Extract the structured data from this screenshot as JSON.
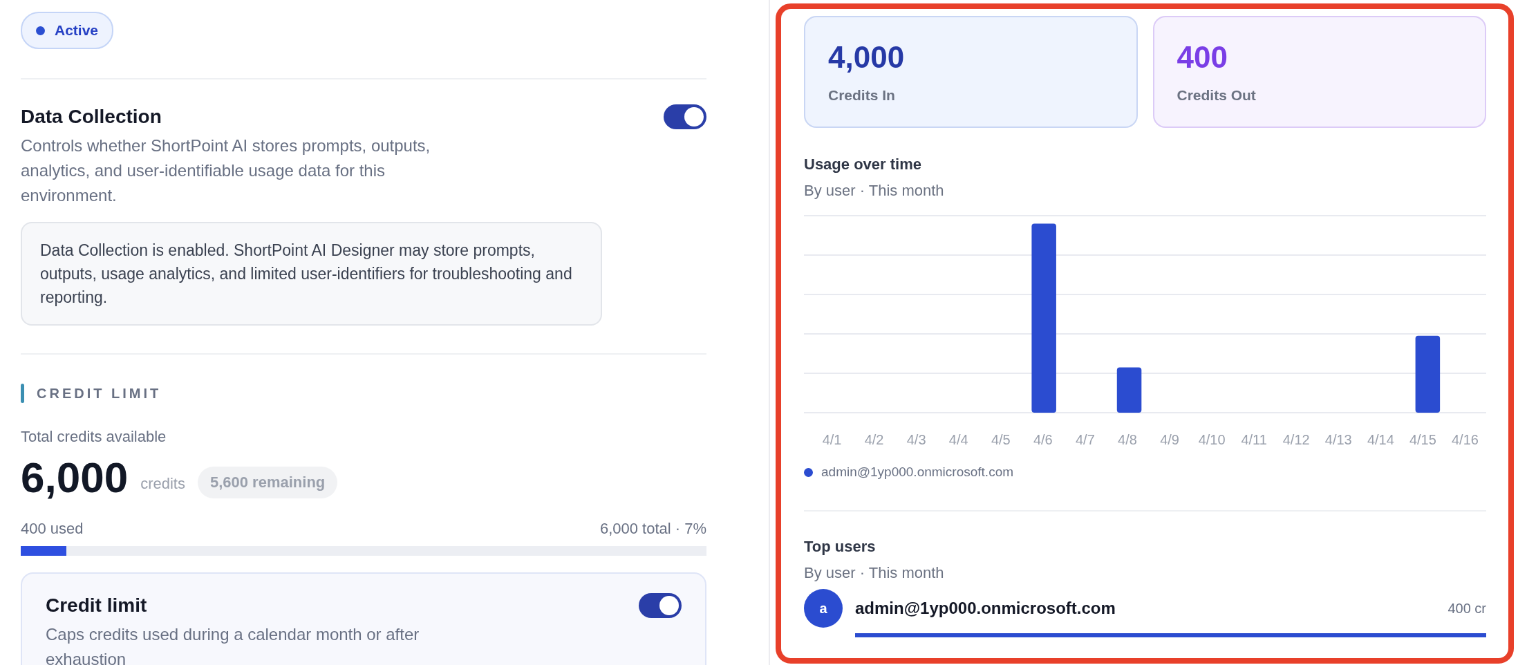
{
  "status_badge": {
    "label": "Active",
    "color": "#2b4fd1"
  },
  "data_collection": {
    "title": "Data Collection",
    "on": true,
    "description": "Controls whether ShortPoint AI stores prompts, outputs, analytics, and user-identifiable usage data for this environment.",
    "notice": "Data Collection is enabled. ShortPoint AI Designer may store prompts, outputs, usage analytics, and limited user-identifiers for troubleshooting and reporting."
  },
  "credit_section": {
    "heading": "CREDIT LIMIT",
    "total_label": "Total credits available",
    "total": "6,000",
    "unit": "credits",
    "remaining": "5,600 remaining",
    "used": "400 used",
    "summary": "6,000 total · 7%",
    "level": 0.067
  },
  "credit_limit_card": {
    "title": "Credit limit",
    "on": true,
    "description": "Caps credits used during a calendar month or after exhaustion"
  },
  "stats": [
    {
      "value": "4,000",
      "label": "Credits In",
      "kind": "in"
    },
    {
      "value": "400",
      "label": "Credits Out",
      "kind": "out"
    }
  ],
  "usage_chart": {
    "title": "Usage over time",
    "subtitle": "By user · This month",
    "x_labels": [
      "4/1",
      "4/2",
      "4/3",
      "4/4",
      "4/5",
      "4/6",
      "4/7",
      "4/8",
      "4/9",
      "4/10",
      "4/11",
      "4/12",
      "4/13",
      "4/14",
      "4/15",
      "4/16"
    ],
    "legend": [
      {
        "name": "admin@1yp000.onmicrosoft.com",
        "color": "#2b4cd0"
      }
    ]
  },
  "top_users": {
    "title": "Top users",
    "subtitle": "By user · This month",
    "users": [
      {
        "initial": "a",
        "email": "admin@1yp000.onmicrosoft.com",
        "credits": "400 cr"
      }
    ]
  }
}
